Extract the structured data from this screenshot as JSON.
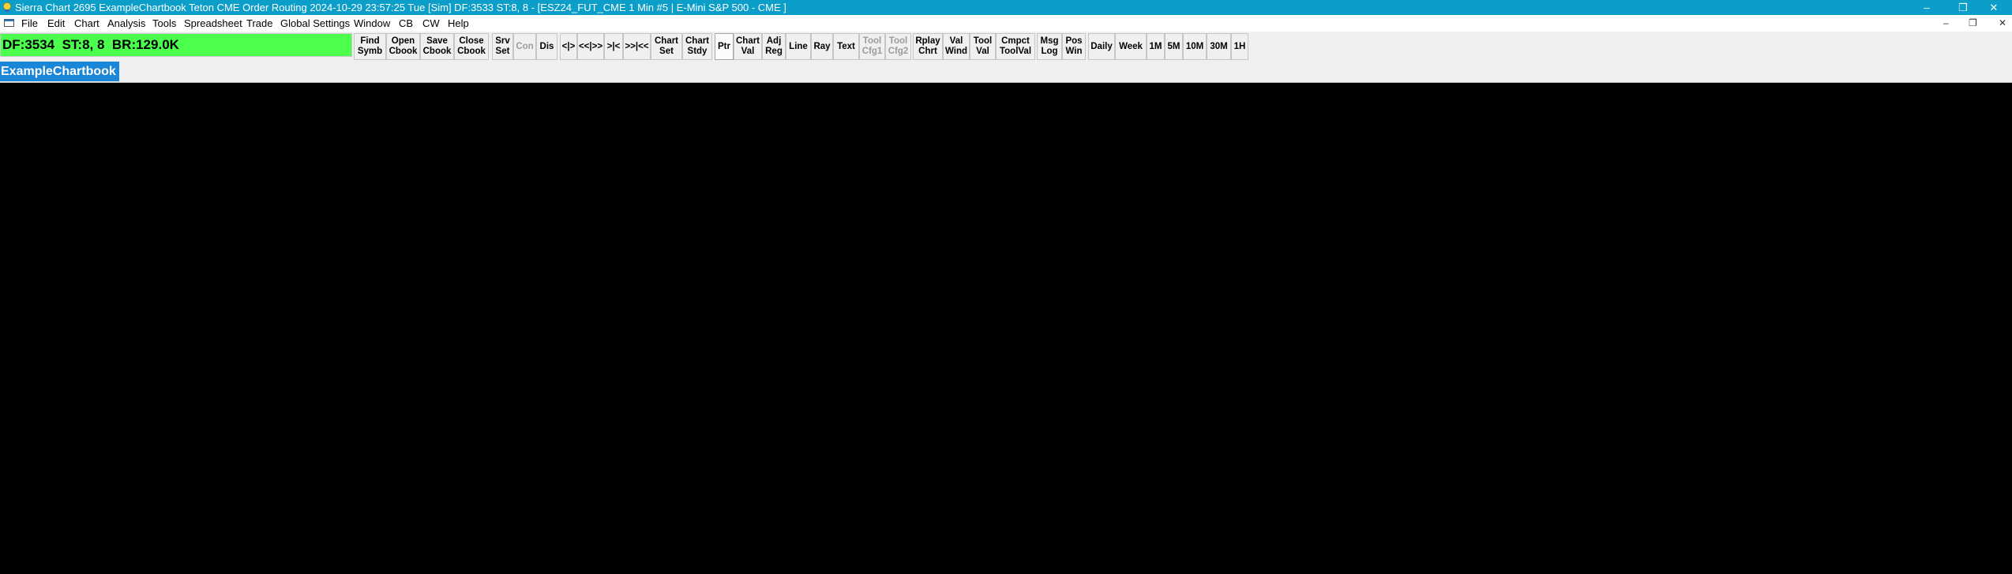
{
  "window": {
    "title": "Sierra Chart 2695 ExampleChartbook Teton CME Order Routing 2024-10-29  23:57:25 Tue [Sim] DF:3533  ST:8, 8 - [ESZ24_FUT_CME  1 Min  #5 | E-Mini S&P 500 - CME ]",
    "minimize": "–",
    "restore": "❐",
    "close": "✕"
  },
  "menu": {
    "items": [
      "File",
      "Edit",
      "Chart",
      "Analysis",
      "Tools",
      "Spreadsheet",
      "Trade",
      "Global Settings",
      "Window",
      "CB",
      "CW",
      "Help"
    ],
    "mdi_minimize": "–",
    "mdi_restore": "❐",
    "mdi_close": "✕"
  },
  "status": {
    "text": "DF:3534  ST:8, 8  BR:129.0K",
    "color": "#4dff4d"
  },
  "toolbar": {
    "find_symbol": [
      "Find",
      "Symb"
    ],
    "open_chartbook": [
      "Open",
      "Cbook"
    ],
    "save_chartbook": [
      "Save",
      "Cbook"
    ],
    "close_chartbook": [
      "Close",
      "Cbook"
    ],
    "server_settings": [
      "Srv",
      "Set"
    ],
    "connect": "Con",
    "disconnect": "Dis",
    "scroll_back": "<|>",
    "scroll_center": "<<|>>",
    "scroll_right_edge": ">|<",
    "scroll_end": ">>|<<",
    "chart_settings": [
      "Chart",
      "Set"
    ],
    "chart_studies": [
      "Chart",
      "Stdy"
    ],
    "pointer": "Ptr",
    "chart_values": [
      "Chart",
      "Val"
    ],
    "adjust_region": [
      "Adj",
      "Reg"
    ],
    "line": "Line",
    "ray": "Ray",
    "text": "Text",
    "tool_config_1": [
      "Tool",
      "Cfg1"
    ],
    "tool_config_2": [
      "Tool",
      "Cfg2"
    ],
    "replay_chart": [
      "Rplay",
      "Chrt"
    ],
    "values_window": [
      "Val",
      "Wind"
    ],
    "tool_values": [
      "Tool",
      "Val"
    ],
    "compact_tool_values": [
      "Cmpct",
      "ToolVal"
    ],
    "message_log": [
      "Msg",
      "Log"
    ],
    "position_window": [
      "Pos",
      "Win"
    ],
    "daily": "Daily",
    "week": "Week",
    "tf_1m": "1M",
    "tf_5m": "5M",
    "tf_10m": "10M",
    "tf_30m": "30M",
    "tf_1h": "1H"
  },
  "tabs": {
    "active": "ExampleChartbook",
    "active_color": "#1a86d8"
  },
  "colors": {
    "titlebar": "#0a9ec9",
    "chart_background": "#000000"
  }
}
